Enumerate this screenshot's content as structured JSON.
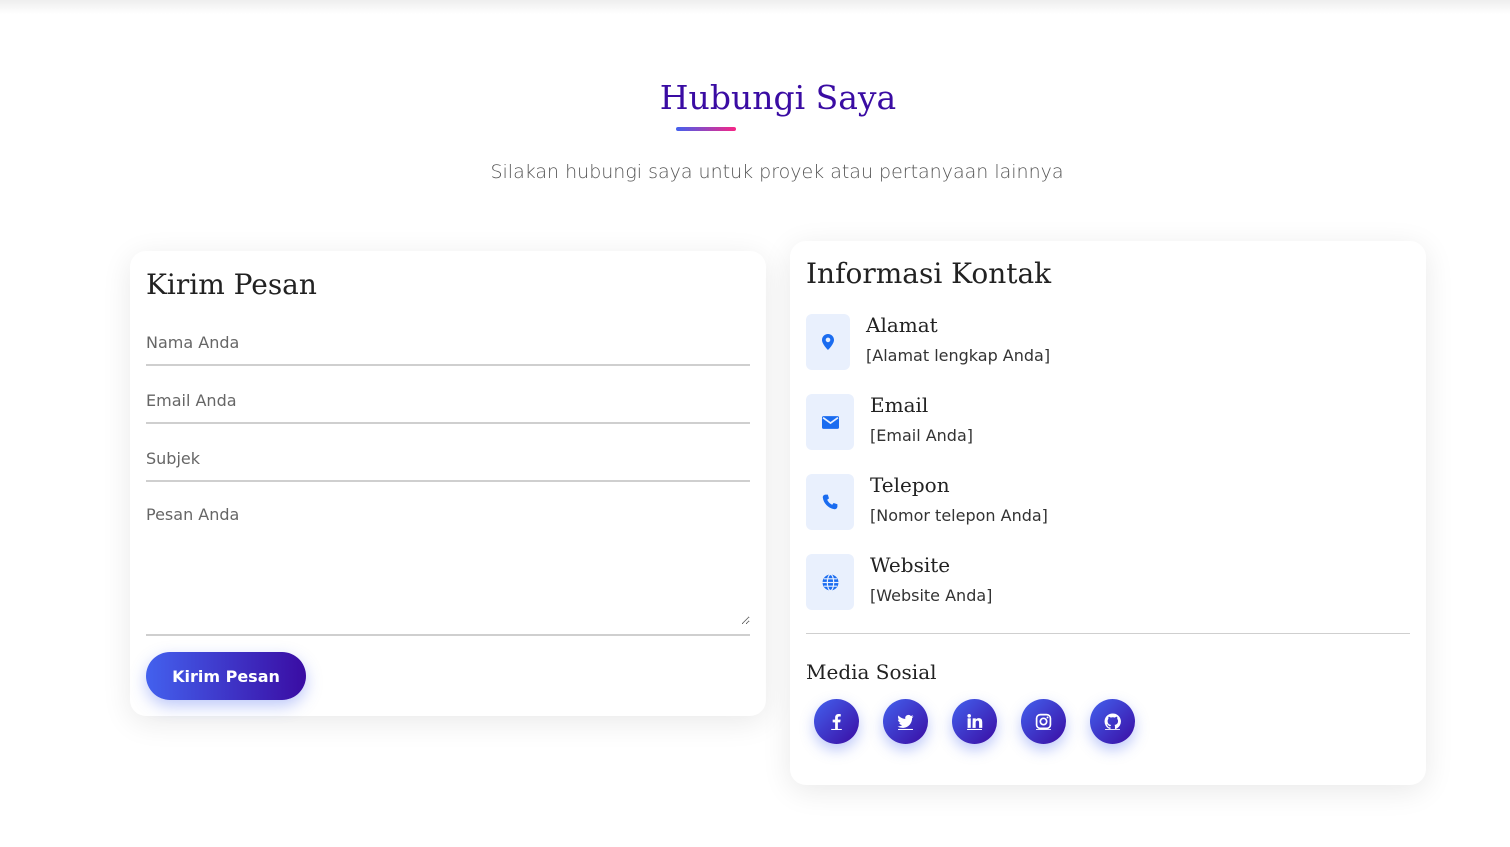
{
  "header": {
    "title": "Hubungi Saya",
    "subtitle": "Silakan hubungi saya untuk proyek atau pertanyaan lainnya"
  },
  "form": {
    "title": "Kirim Pesan",
    "name_placeholder": "Nama Anda",
    "email_placeholder": "Email Anda",
    "subject_placeholder": "Subjek",
    "message_placeholder": "Pesan Anda",
    "submit_label": "Kirim Pesan"
  },
  "info": {
    "title": "Informasi Kontak",
    "items": [
      {
        "icon": "map-marker-icon",
        "title": "Alamat",
        "value": "[Alamat lengkap Anda]"
      },
      {
        "icon": "envelope-icon",
        "title": "Email",
        "value": "[Email Anda]"
      },
      {
        "icon": "phone-icon",
        "title": "Telepon",
        "value": "[Nomor telepon Anda]"
      },
      {
        "icon": "globe-icon",
        "title": "Website",
        "value": "[Website Anda]"
      }
    ],
    "social_title": "Media Sosial",
    "social": [
      "facebook-icon",
      "twitter-icon",
      "linkedin-icon",
      "instagram-icon",
      "github-icon"
    ]
  },
  "colors": {
    "primary": "#4361ee",
    "secondary": "#3a0ca3",
    "accent": "#f72585",
    "icon_bg": "#e9f0fd",
    "icon_color": "#1a6cf0"
  }
}
